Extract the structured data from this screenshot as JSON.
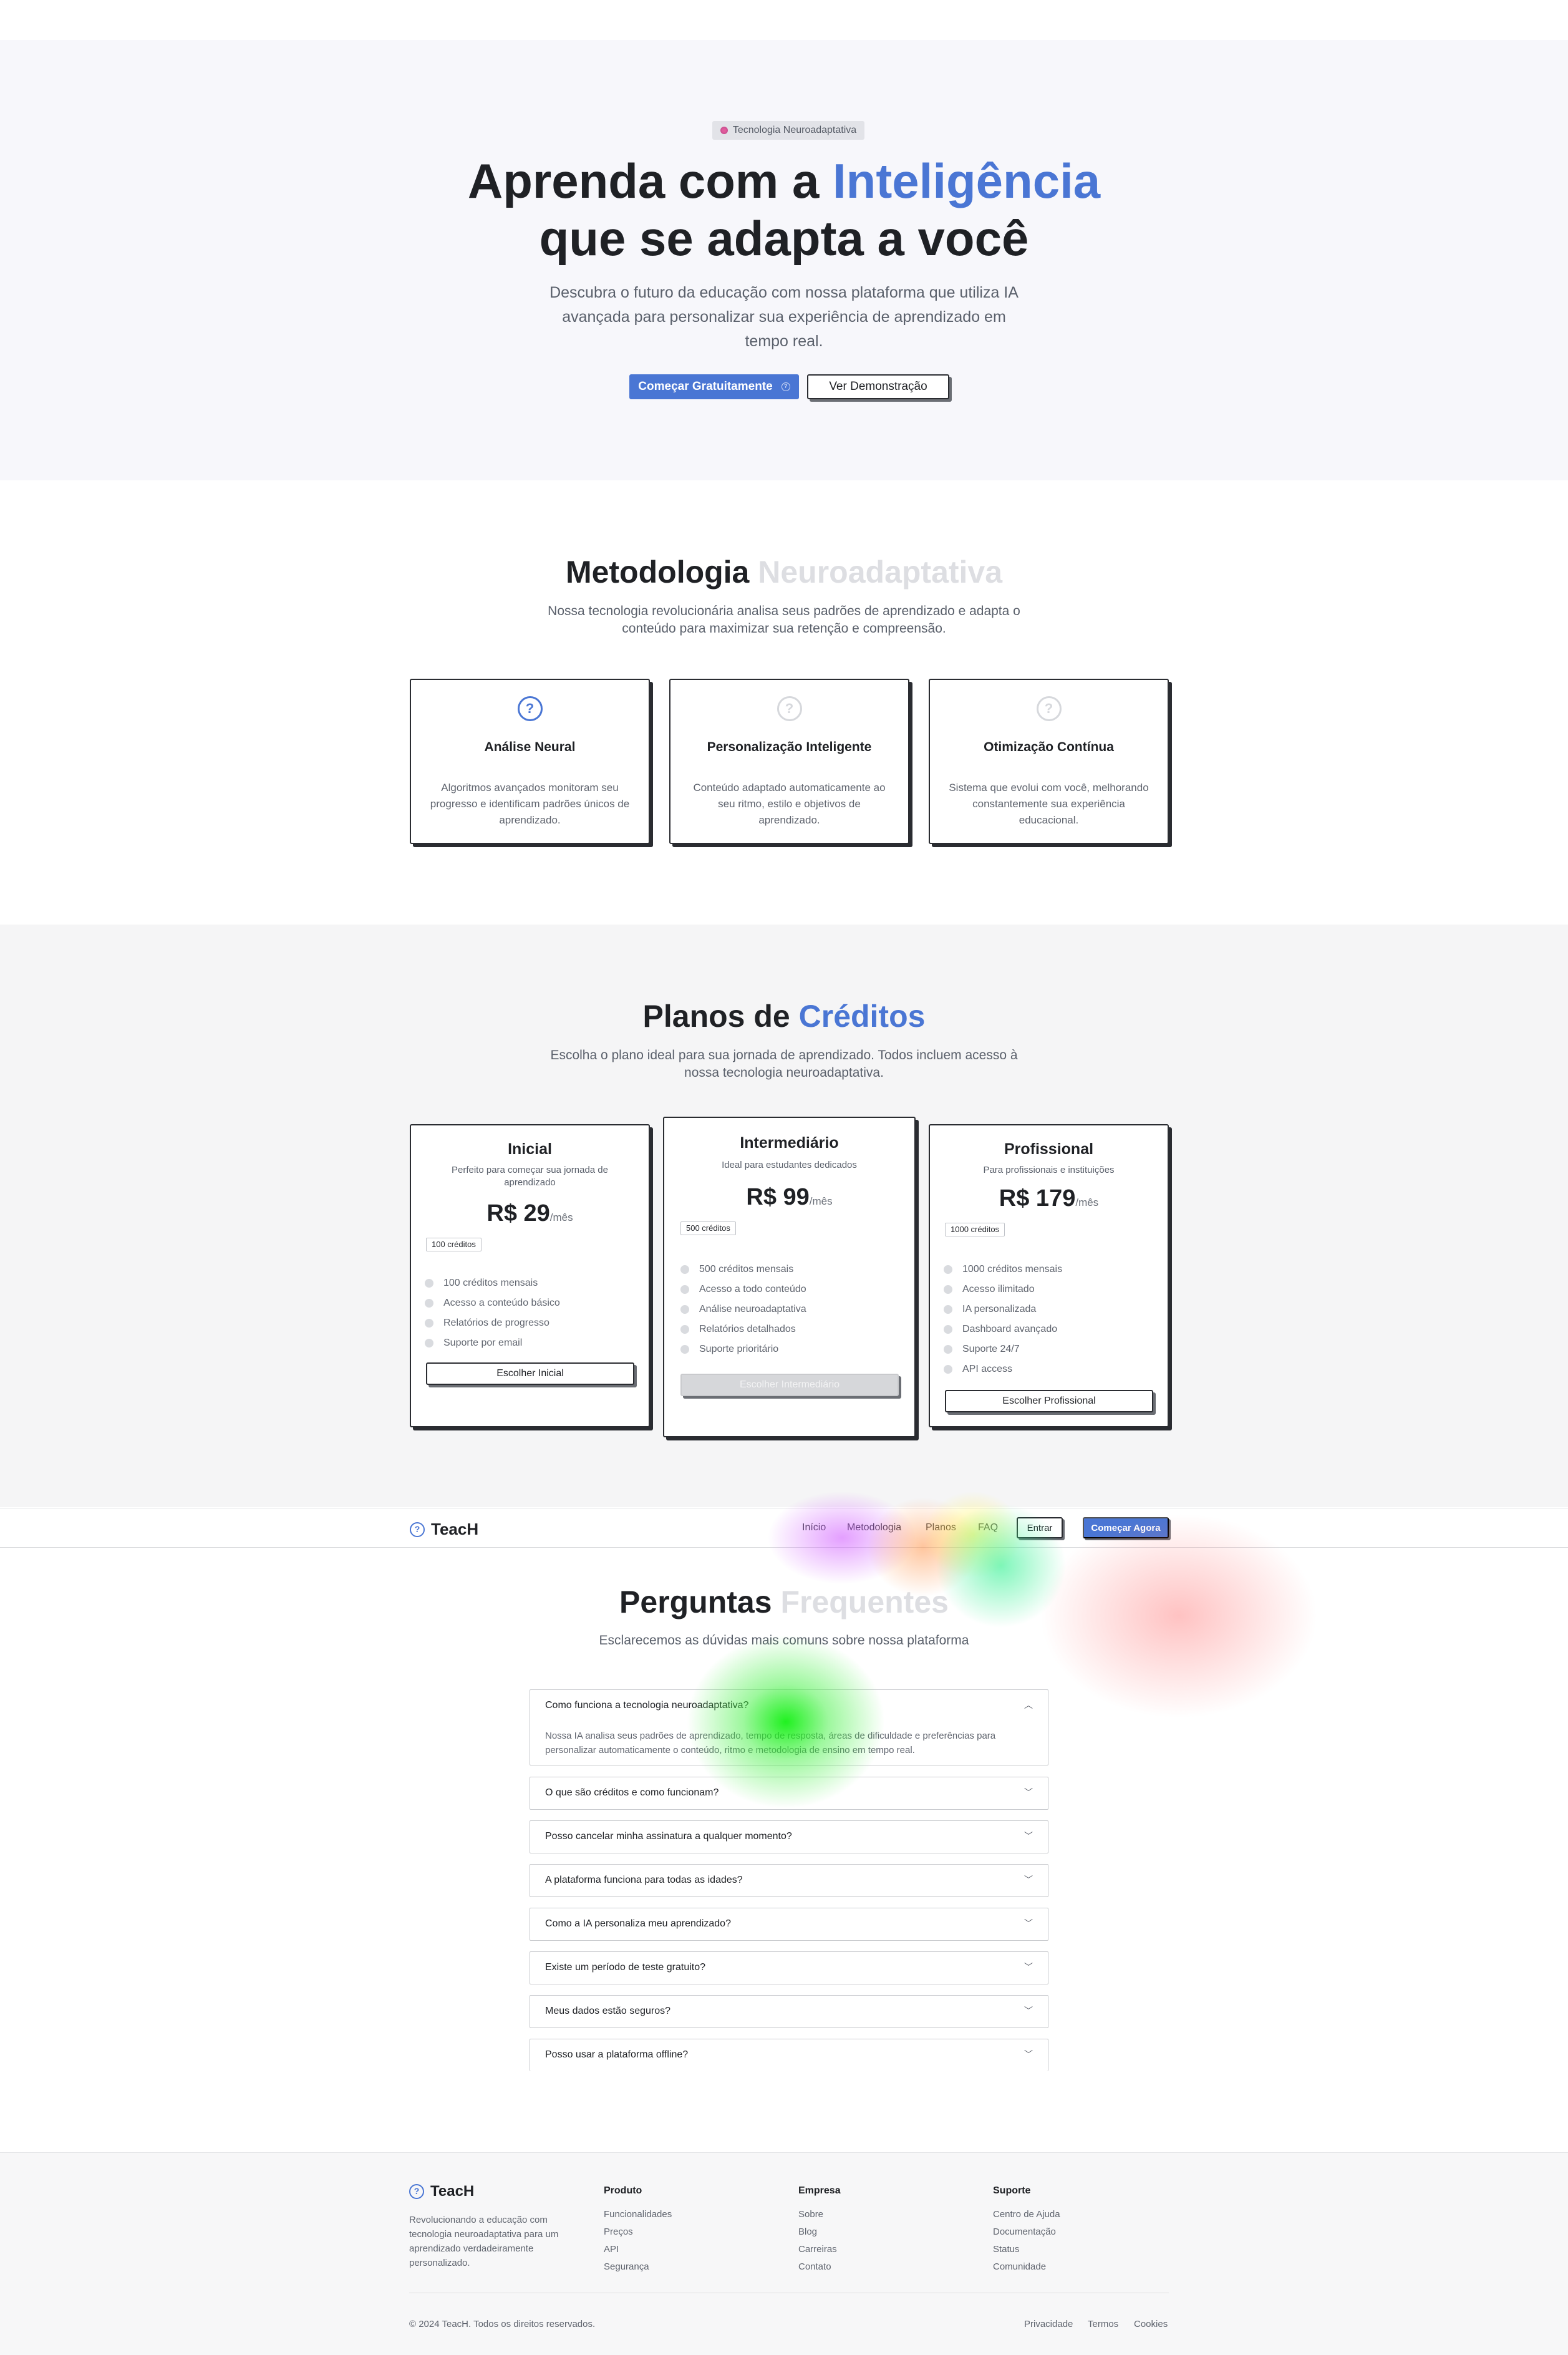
{
  "hero": {
    "badge": "Tecnologia Neuroadaptativa",
    "title_part1": "Aprenda com a ",
    "title_accent": "Inteligência",
    "title_part2": "que se adapta a você",
    "subtitle": "Descubra o futuro da educação com nossa plataforma que utiliza IA avançada para personalizar sua experiência de aprendizado em tempo real.",
    "primary_button": "Começar Gratuitamente",
    "secondary_button": "Ver Demonstração"
  },
  "methodology": {
    "title_part1": "Metodologia ",
    "title_accent": "Neuroadaptativa",
    "subtitle": "Nossa tecnologia revolucionária analisa seus padrões de aprendizado e adapta o conteúdo para maximizar sua retenção e compreensão.",
    "cards": [
      {
        "icon": "help-circle-icon",
        "title": "Análise Neural",
        "text": "Algoritmos avançados monitoram seu progresso e identificam padrões únicos de aprendizado."
      },
      {
        "icon": "help-circle-icon",
        "title": "Personalização Inteligente",
        "text": "Conteúdo adaptado automaticamente ao seu ritmo, estilo e objetivos de aprendizado."
      },
      {
        "icon": "help-circle-icon",
        "title": "Otimização Contínua",
        "text": "Sistema que evolui com você, melhorando constantemente sua experiência educacional."
      }
    ]
  },
  "plans": {
    "title_part1": "Planos de ",
    "title_accent": "Créditos",
    "subtitle": "Escolha o plano ideal para sua jornada de aprendizado. Todos incluem acesso à nossa tecnologia neuroadaptativa.",
    "items": [
      {
        "name": "Inicial",
        "desc": "Perfeito para começar sua jornada de aprendizado",
        "price": "R$ 29",
        "period": "/mês",
        "credits": "100 créditos",
        "features": [
          "100 créditos mensais",
          "Acesso a conteúdo básico",
          "Relatórios de progresso",
          "Suporte por email"
        ],
        "button": "Escolher Inicial"
      },
      {
        "name": "Intermediário",
        "desc": "Ideal para estudantes dedicados",
        "price": "R$ 99",
        "period": "/mês",
        "credits": "500 créditos",
        "features": [
          "500 créditos mensais",
          "Acesso a todo conteúdo",
          "Análise neuroadaptativa",
          "Relatórios detalhados",
          "Suporte prioritário"
        ],
        "button": "Escolher Intermediário"
      },
      {
        "name": "Profissional",
        "desc": "Para profissionais e instituições",
        "price": "R$ 179",
        "period": "/mês",
        "credits": "1000 créditos",
        "features": [
          "1000 créditos mensais",
          "Acesso ilimitado",
          "IA personalizada",
          "Dashboard avançado",
          "Suporte 24/7",
          "API access"
        ],
        "button": "Escolher Profissional"
      }
    ]
  },
  "nav": {
    "brand": "TeacH",
    "links": [
      "Início",
      "Metodologia",
      "Planos",
      "FAQ"
    ],
    "login": "Entrar",
    "cta": "Começar Agora"
  },
  "faq": {
    "title_part1": "Perguntas ",
    "title_accent": "Frequentes",
    "subtitle": "Esclarecemos as dúvidas mais comuns sobre nossa plataforma",
    "items": [
      {
        "q": "Como funciona a tecnologia neuroadaptativa?",
        "a": "Nossa IA analisa seus padrões de aprendizado, tempo de resposta, áreas de dificuldade e preferências para personalizar automaticamente o conteúdo, ritmo e metodologia de ensino em tempo real."
      },
      {
        "q": "O que são créditos e como funcionam?"
      },
      {
        "q": "Posso cancelar minha assinatura a qualquer momento?"
      },
      {
        "q": "A plataforma funciona para todas as idades?"
      },
      {
        "q": "Como a IA personaliza meu aprendizado?"
      },
      {
        "q": "Existe um período de teste gratuito?"
      },
      {
        "q": "Meus dados estão seguros?"
      },
      {
        "q": "Posso usar a plataforma offline?"
      }
    ]
  },
  "footer": {
    "brand": "TeacH",
    "description": "Revolucionando a educação com tecnologia neuroadaptativa para um aprendizado verdadeiramente personalizado.",
    "columns": [
      {
        "title": "Produto",
        "links": [
          "Funcionalidades",
          "Preços",
          "API",
          "Segurança"
        ]
      },
      {
        "title": "Empresa",
        "links": [
          "Sobre",
          "Blog",
          "Carreiras",
          "Contato"
        ]
      },
      {
        "title": "Suporte",
        "links": [
          "Centro de Ajuda",
          "Documentação",
          "Status",
          "Comunidade"
        ]
      }
    ],
    "copyright": "© 2024 TeacH. Todos os direitos reservados.",
    "legal": [
      "Privacidade",
      "Termos",
      "Cookies"
    ]
  },
  "colors": {
    "accent": "#4a76d4",
    "text": "#1f2125",
    "muted": "#5a606b"
  }
}
